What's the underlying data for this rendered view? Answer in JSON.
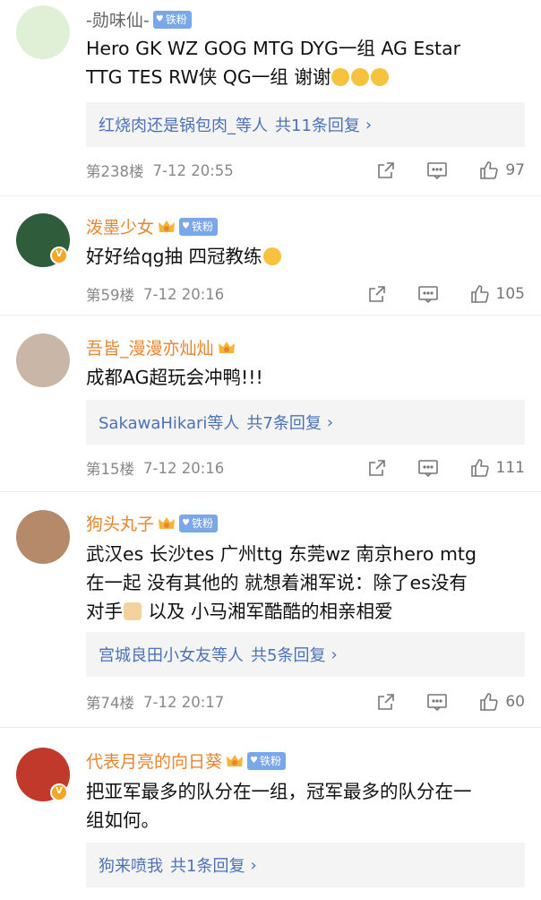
{
  "comments": [
    {
      "user": "-勋味仙-",
      "badge": "铁粉",
      "text_1": "Hero GK WZ GOG MTG DYG一组 AG Estar",
      "text_2": "TTG TES RW侠 QG一组 谢谢",
      "replies_user": "红烧肉还是锅包肉_等人",
      "replies_count": "共11条回复",
      "floor": "第238楼",
      "time": "7-12 20:55",
      "likes": "97"
    },
    {
      "user": "泼墨少女",
      "badge": "铁粉",
      "text_1": "好好给qg抽 四冠教练",
      "floor": "第59楼",
      "time": "7-12 20:16",
      "likes": "105"
    },
    {
      "user": "吾皆_漫漫亦灿灿",
      "text_1": "成都AG超玩会冲鸭!!!",
      "replies_user": "SakawaHikari等人",
      "replies_count": "共7条回复",
      "floor": "第15楼",
      "time": "7-12 20:16",
      "likes": "111"
    },
    {
      "user": "狗头丸子",
      "badge": "铁粉",
      "text_1": "武汉es 长沙tes 广州ttg 东莞wz 南京hero mtg",
      "text_2": "在一起 没有其他的 就想着湘军说：除了es没有",
      "text_3a": "对手",
      "text_3b": " 以及 小马湘军酷酷的相亲相爱",
      "replies_user": "宫城良田小女友等人",
      "replies_count": "共5条回复",
      "floor": "第74楼",
      "time": "7-12 20:17",
      "likes": "60"
    },
    {
      "user": "代表月亮的向日葵",
      "badge": "铁粉",
      "text_1": "把亚军最多的队分在一组，冠军最多的队分在一",
      "text_2": "组如何。",
      "replies_user": "狗来喷我",
      "replies_count": "共1条回复"
    }
  ],
  "colors": {
    "username": "#e8852d",
    "link": "#4a72b7",
    "badge": "#7aa7e8",
    "meta": "#888888"
  }
}
